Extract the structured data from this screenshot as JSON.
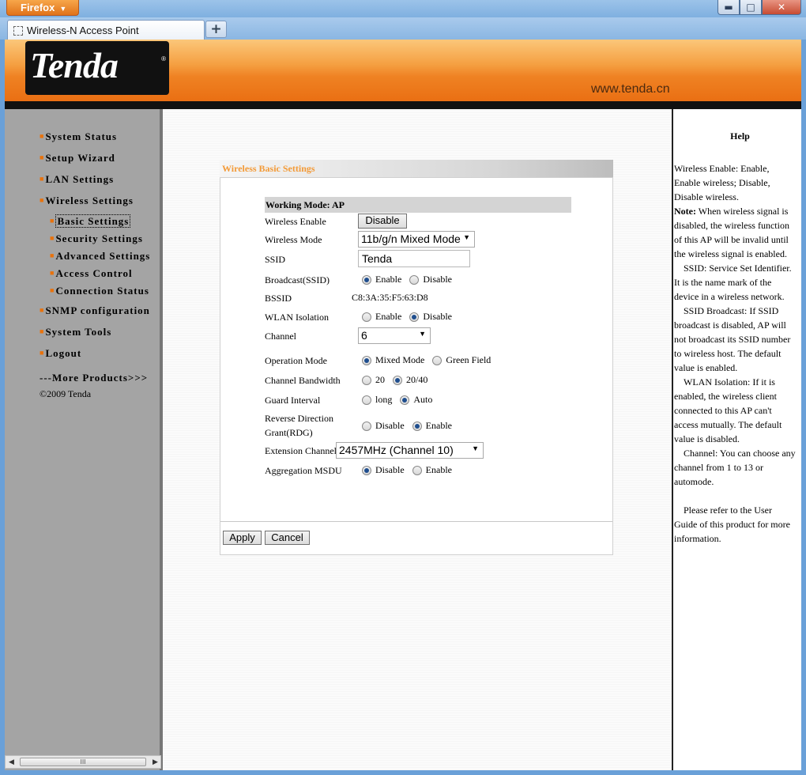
{
  "browser": {
    "menu_button": "Firefox",
    "tab_title": "Wireless-N Access Point",
    "new_tab": "+",
    "window_buttons": {
      "minimize": "▬",
      "maximize": "□",
      "close": "✕"
    }
  },
  "header": {
    "logo": "Tenda",
    "logo_reg": "®",
    "url": "www.tenda.cn",
    "colors": {
      "banner_orange": "#ef8223",
      "logo_bg": "#111111"
    }
  },
  "sidebar": {
    "items": [
      {
        "label": "System Status"
      },
      {
        "label": "Setup Wizard"
      },
      {
        "label": "LAN Settings"
      },
      {
        "label": "Wireless Settings"
      },
      {
        "label": "Basic Settings"
      },
      {
        "label": "Security Settings"
      },
      {
        "label": "Advanced Settings"
      },
      {
        "label": "Access Control"
      },
      {
        "label": "Connection Status"
      },
      {
        "label": "SNMP configuration"
      },
      {
        "label": "System Tools"
      },
      {
        "label": "Logout"
      }
    ],
    "bullet": "■",
    "more_products": "---More Products>>>",
    "copyright": "©2009 Tenda"
  },
  "form": {
    "heading": "Wireless Basic Settings",
    "working_mode": "Working Mode: AP",
    "wireless_enable": {
      "label": "Wireless Enable",
      "button": "Disable"
    },
    "wireless_mode": {
      "label": "Wireless Mode",
      "value": "11b/g/n Mixed Mode"
    },
    "ssid": {
      "label": "SSID",
      "value": "Tenda"
    },
    "broadcast": {
      "label": "Broadcast(SSID)",
      "options": [
        "Enable",
        "Disable"
      ],
      "selected": "Enable"
    },
    "bssid": {
      "label": "BSSID",
      "value": "C8:3A:35:F5:63:D8"
    },
    "wlan_isolation": {
      "label": "WLAN Isolation",
      "options": [
        "Enable",
        "Disable"
      ],
      "selected": "Disable"
    },
    "channel": {
      "label": "Channel",
      "value": "6"
    },
    "operation_mode": {
      "label": "Operation Mode",
      "options": [
        "Mixed Mode",
        "Green Field"
      ],
      "selected": "Mixed Mode"
    },
    "channel_bandwidth": {
      "label": "Channel Bandwidth",
      "options": [
        "20",
        "20/40"
      ],
      "selected": "20/40"
    },
    "guard_interval": {
      "label": "Guard Interval",
      "options": [
        "long",
        "Auto"
      ],
      "selected": "Auto"
    },
    "rdg": {
      "label_line1": "Reverse Direction",
      "label_line2": "Grant(RDG)",
      "options": [
        "Disable",
        "Enable"
      ],
      "selected": "Enable"
    },
    "extension_channel": {
      "label": "Extension Channel",
      "value": "2457MHz (Channel 10)"
    },
    "aggregation_msdu": {
      "label": "Aggregation MSDU",
      "options": [
        "Disable",
        "Enable"
      ],
      "selected": "Disable"
    },
    "apply": "Apply",
    "cancel": "Cancel",
    "colors": {
      "heading": "#f39a37"
    }
  },
  "help": {
    "title": "Help",
    "p1": "Wireless Enable: Enable, Enable wireless; Disable, Disable wireless.",
    "note_label": "Note:",
    "note_text": " When wireless signal is disabled, the wireless function of this AP will be invalid until the wireless signal is enabled.",
    "p2": "SSID: Service Set Identifier. It is the name mark of the device in a wireless network.",
    "p3": "SSID Broadcast: If SSID broadcast is disabled, AP will not broadcast its SSID number to wireless host. The default value is enabled.",
    "p4": "WLAN Isolation: If it is enabled, the wireless client connected to this AP can't access mutually. The default value is disabled.",
    "p5": "Channel: You can choose any channel from 1 to 13 or automode.",
    "p6": "Please refer to the User Guide of this product for more information."
  },
  "scrollbar": {
    "left": "◀",
    "right": "▶",
    "grip": "III"
  }
}
